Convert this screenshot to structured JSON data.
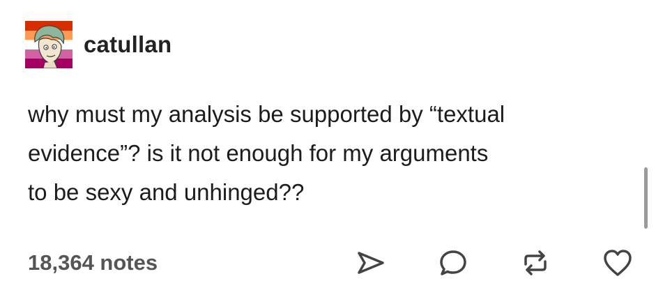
{
  "post": {
    "username": "catullan",
    "body": "why must my analysis be supported by “textual\nevidence”? is it not enough for my arguments\nto be sexy and unhinged??",
    "notes": "18,364 notes"
  },
  "actions": {
    "share_icon": "paper-plane-icon",
    "reply_icon": "speech-bubble-icon",
    "reblog_icon": "reblog-icon",
    "like_icon": "heart-icon"
  },
  "colors": {
    "text": "#1c1c1c",
    "notes_text": "#555555",
    "icon_stroke": "#444444",
    "avatar_stripes": [
      "#d62e00",
      "#ff9a56",
      "#ffffff",
      "#d362a4",
      "#a30262"
    ]
  }
}
